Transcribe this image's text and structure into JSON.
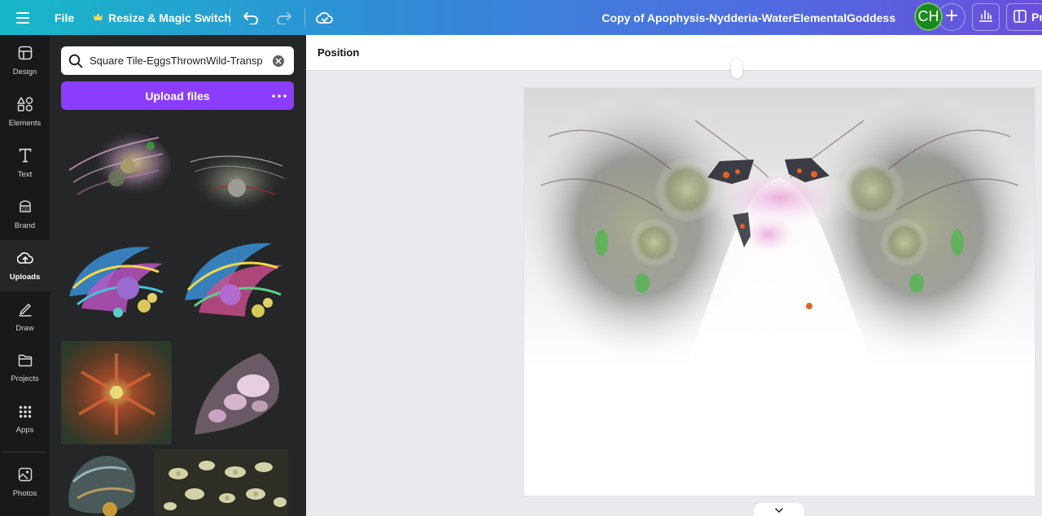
{
  "topbar": {
    "file_label": "File",
    "resize_label": "Resize & Magic Switch",
    "doc_title": "Copy of Apophysis-Nydderia-WaterElementalGoddess",
    "avatar_initials": "CH",
    "present_label": "Pr",
    "icons": [
      "menu-icon",
      "crown-icon",
      "undo-icon",
      "redo-icon",
      "cloud-save-icon",
      "plus-icon",
      "analytics-icon",
      "present-icon"
    ]
  },
  "rail": {
    "items": [
      {
        "label": "Design",
        "icon": "design-icon"
      },
      {
        "label": "Elements",
        "icon": "elements-icon"
      },
      {
        "label": "Text",
        "icon": "text-icon"
      },
      {
        "label": "Brand",
        "icon": "brand-icon"
      },
      {
        "label": "Uploads",
        "icon": "uploads-icon",
        "active": true
      },
      {
        "label": "Draw",
        "icon": "draw-icon"
      },
      {
        "label": "Projects",
        "icon": "projects-icon"
      },
      {
        "label": "Apps",
        "icon": "apps-icon"
      },
      {
        "label": "Photos",
        "icon": "photos-icon"
      }
    ]
  },
  "panel": {
    "search_value": "Square Tile-EggsThrownWild-Transp",
    "upload_label": "Upload files"
  },
  "editor": {
    "position_label": "Position"
  },
  "colors": {
    "brand_purple": "#8b3dff",
    "rail_bg": "#18191b",
    "panel_bg": "#252627",
    "avatar_bg": "#1a8a1a"
  }
}
